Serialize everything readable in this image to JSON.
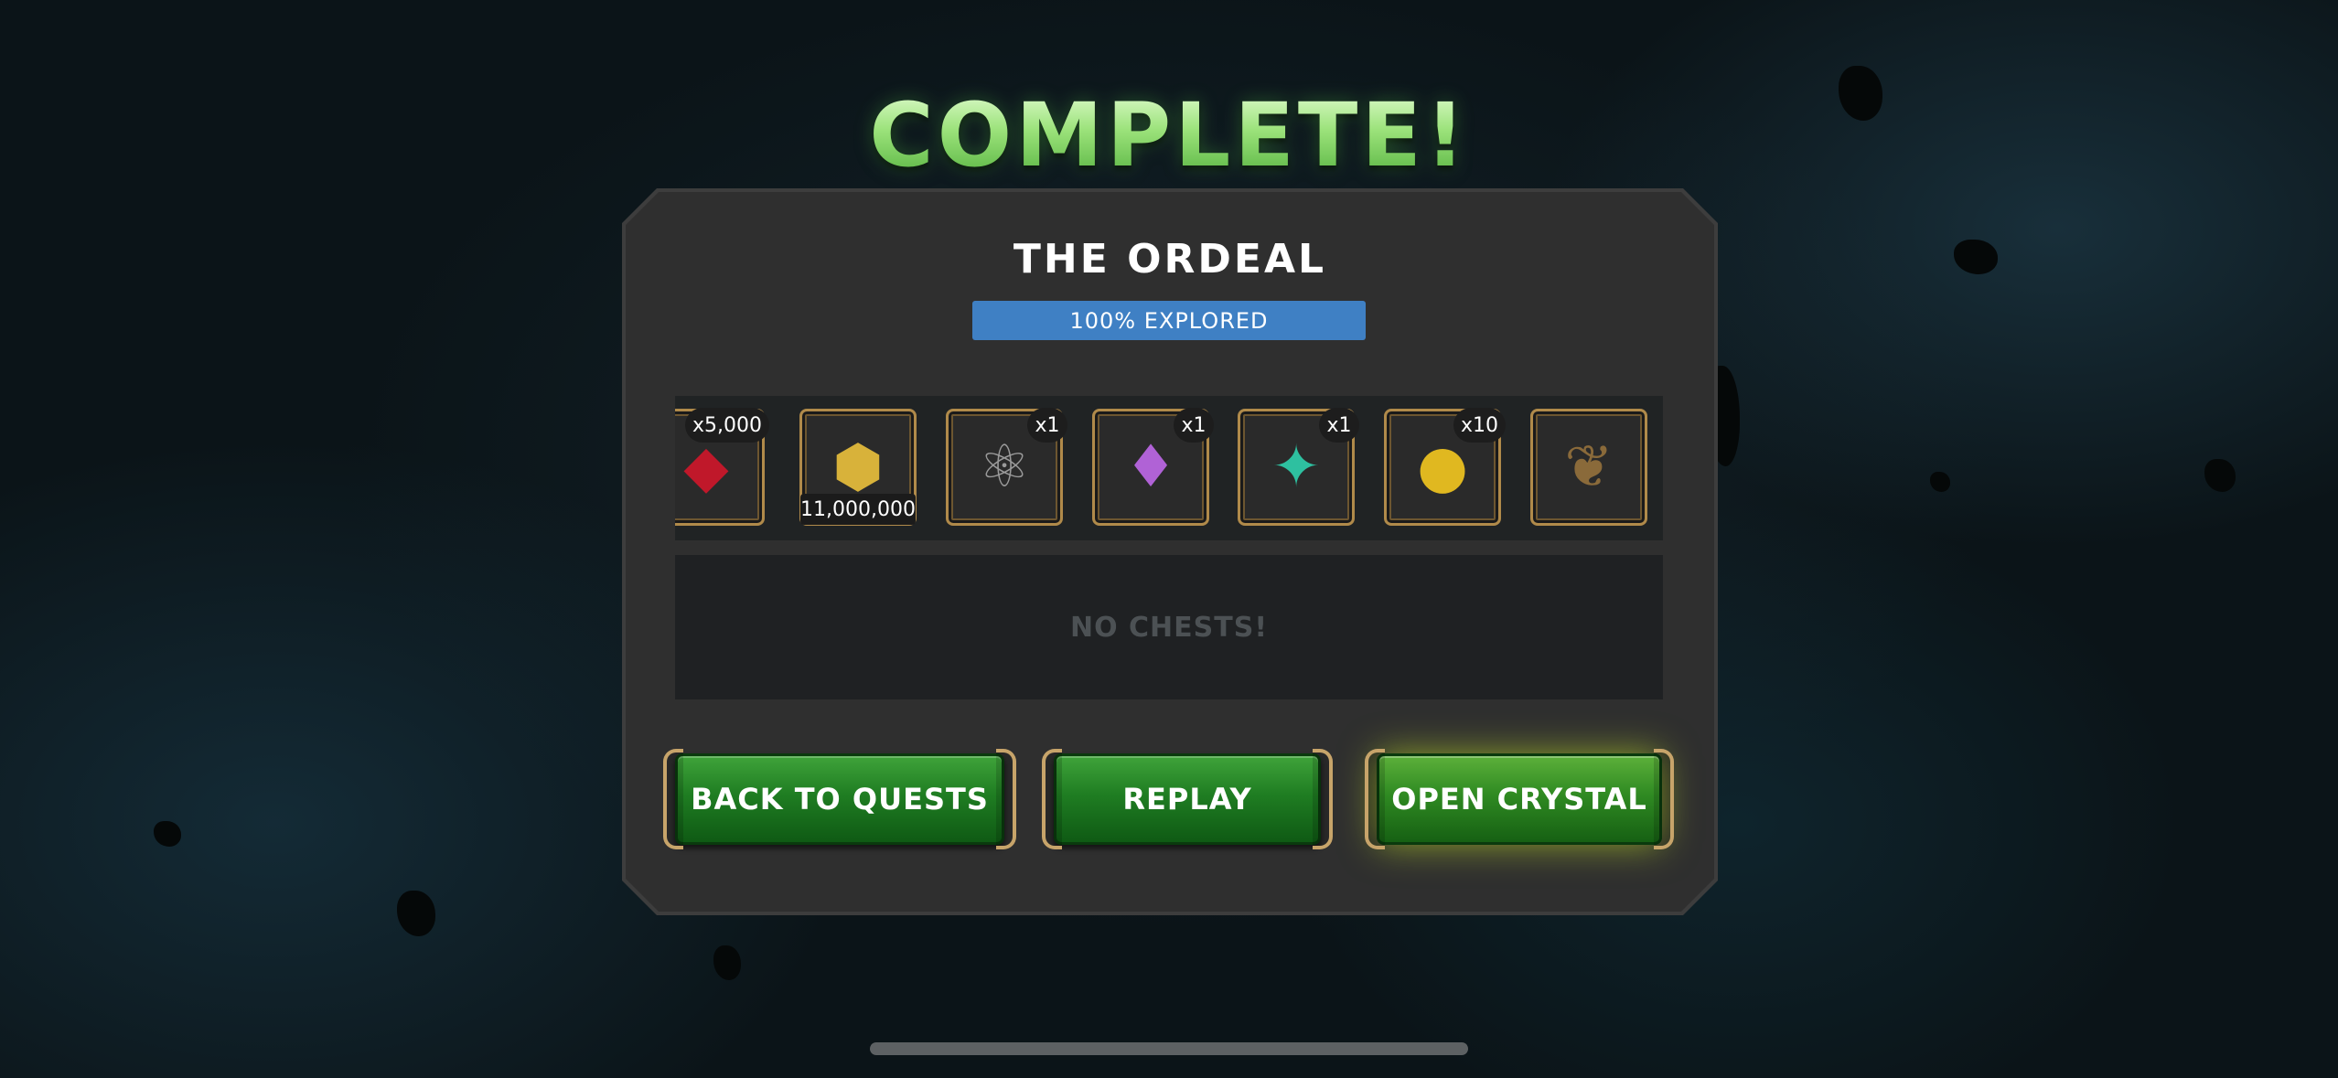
{
  "header": {
    "title": "COMPLETE!"
  },
  "quest": {
    "name": "THE ORDEAL",
    "progress_label": "100% EXPLORED",
    "progress_percent": 100
  },
  "rewards": [
    {
      "icon": "red-crystal-shards-icon",
      "glyph": "◆",
      "color": "#c0182a",
      "badge": "x5,000"
    },
    {
      "icon": "gold-ore-icon",
      "glyph": "⬢",
      "color": "#d8b23a",
      "amount": "11,000,000"
    },
    {
      "icon": "catalyst-molecule-icon",
      "glyph": "⚛",
      "color": "#9a9a9a",
      "badge": "x1"
    },
    {
      "icon": "mystic-crystal-icon",
      "glyph": "♦",
      "color": "#b062d6",
      "badge": "x1"
    },
    {
      "icon": "teal-crystal-shard-icon",
      "glyph": "✦",
      "color": "#2ec0a0",
      "badge": "x1"
    },
    {
      "icon": "xp-coin-icon",
      "glyph": "●",
      "color": "#e0b820",
      "badge": "x10"
    },
    {
      "icon": "laurel-wreath-icon",
      "glyph": "❦",
      "color": "#8a6a3a"
    }
  ],
  "chests": {
    "empty_label": "NO CHESTS!"
  },
  "buttons": {
    "back": "BACK TO QUESTS",
    "replay": "REPLAY",
    "open_crystal": "OPEN CRYSTAL"
  },
  "colors": {
    "accent_green": "#1f7d22",
    "progress_blue": "#3f80c4",
    "gold_border": "#b08a4a"
  }
}
